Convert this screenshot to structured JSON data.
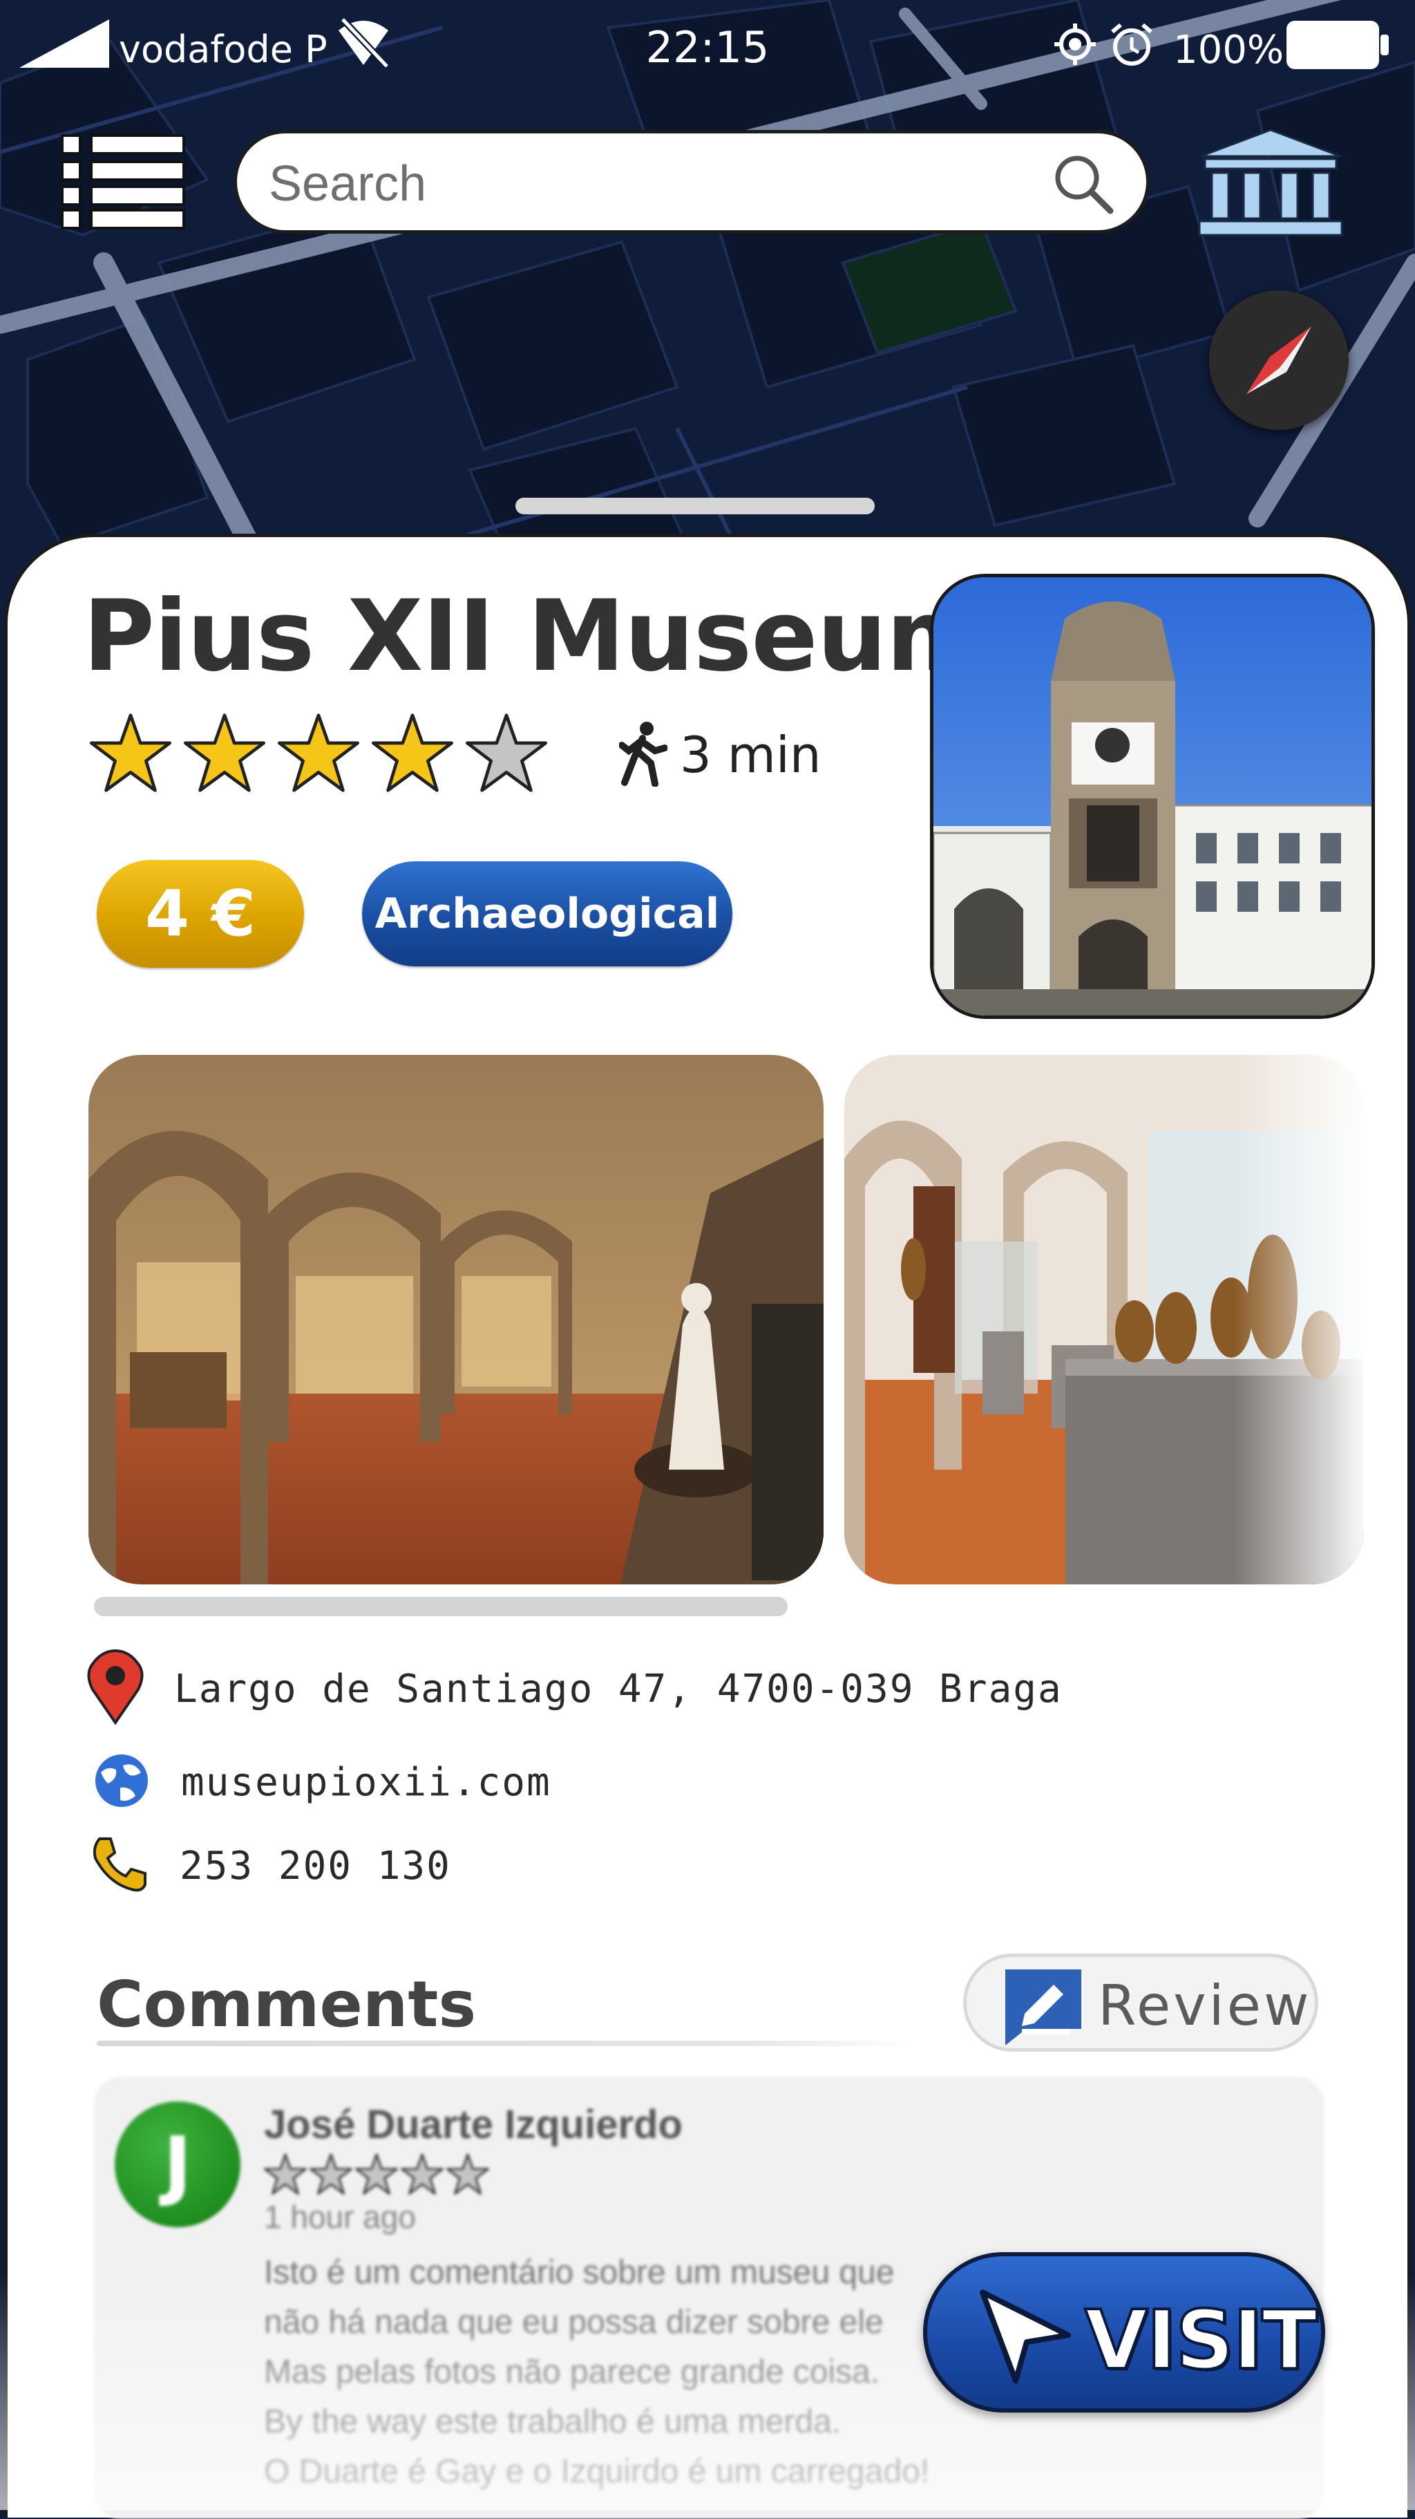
{
  "status_bar": {
    "carrier": "vodafode P",
    "time": "22:15",
    "battery_percent": "100%",
    "icons": [
      "signal-icon",
      "wifi-off-icon",
      "location-icon",
      "alarm-icon",
      "battery-icon"
    ]
  },
  "search": {
    "placeholder": "Search"
  },
  "museum": {
    "name": "Pius XII Museum",
    "rating": 4,
    "rating_max": 5,
    "walk_time": "3 min",
    "price": "4 €",
    "category": "Archaeological",
    "address": "Largo de Santiago 47, 4700-039 Braga",
    "website": "museupioxii.com",
    "phone": "253 200 130"
  },
  "gallery": {
    "scroll_progress": 0.55
  },
  "comments": {
    "title": "Comments",
    "review_label": "Review",
    "items": [
      {
        "avatar_letter": "J",
        "author": "José Duarte Izquierdo",
        "rating": 0,
        "time_ago": "1 hour ago",
        "text_lines": [
          "Isto é um comentário sobre um museu que",
          "não há nada que eu possa dizer sobre ele",
          "Mas pelas fotos não parece grande coisa.",
          "By the way este trabalho é uma merda.",
          "O Duarte é Gay e o Izquirdo é um carregado!"
        ]
      }
    ]
  },
  "visit": {
    "label": "VISIT"
  },
  "colors": {
    "map_bg": "#0f1c3a",
    "price_badge": "#dca300",
    "category_badge": "#1a4fa3",
    "visit_button": "#1a4aa8",
    "star": "#f5c518",
    "avatar": "#1f8f1f"
  }
}
